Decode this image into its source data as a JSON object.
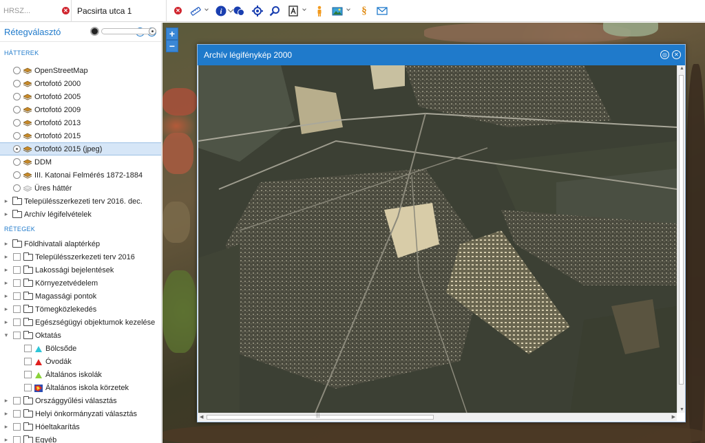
{
  "toolbar": {
    "hrsz_placeholder": "HRSZ...",
    "street_value": "Pacsirta utca 1",
    "icons": [
      "measure-icon",
      "info-icon",
      "identify-icon",
      "locate-icon",
      "search-icon",
      "print-icon",
      "person-icon",
      "map-export-icon",
      "paragraph-icon",
      "mail-icon"
    ],
    "paragraph_glyph": "§",
    "info_glyph": "i"
  },
  "sidebar": {
    "title": "Rétegválasztó",
    "backgrounds_label": "HÁTTEREK",
    "backgrounds": [
      {
        "label": "OpenStreetMap",
        "selected": false
      },
      {
        "label": "Ortofotó 2000",
        "selected": false
      },
      {
        "label": "Ortofotó 2005",
        "selected": false
      },
      {
        "label": "Ortofotó 2009",
        "selected": false
      },
      {
        "label": "Ortofotó 2013",
        "selected": false
      },
      {
        "label": "Ortofotó 2015",
        "selected": false
      },
      {
        "label": "Ortofotó 2015 (jpeg)",
        "selected": true
      },
      {
        "label": "DDM",
        "selected": false
      },
      {
        "label": "III. Katonai Felmérés 1872-1884",
        "selected": false
      },
      {
        "label": "Üres háttér",
        "selected": false
      }
    ],
    "background_folders": [
      "Településszerkezeti terv 2016. dec.",
      "Archív légifelvételek"
    ],
    "layers_label": "RÉTEGEK",
    "layers_top": "Földhivatali alaptérkép",
    "layer_groups": [
      "Településszerkezeti terv 2016",
      "Lakossági bejelentések",
      "Környezetvédelem",
      "Magassági pontok",
      "Tömegközlekedés",
      "Egészségügyi objektumok kezelése",
      "Oktatás"
    ],
    "education_items": [
      {
        "label": "Bölcsőde",
        "icon": "cyan-triangle-icon",
        "color": "#2ec6d8"
      },
      {
        "label": "Óvodák",
        "icon": "red-triangle-icon",
        "color": "#e0201e"
      },
      {
        "label": "Általános iskolák",
        "icon": "green-triangle-icon",
        "color": "#8ad23a"
      },
      {
        "label": "Általános iskola körzetek",
        "icon": "district-map-icon",
        "color": "#e03020"
      }
    ],
    "layer_groups_bottom": [
      "Országgyűlési választás",
      "Helyi önkormányzati választás",
      "Hóeltakarítás",
      "Egyéb"
    ]
  },
  "dialog": {
    "title": "Archív légifénykép 2000",
    "scroll_glyph": "|||"
  },
  "colors": {
    "accent": "#1f7acb",
    "selected_row": "#d6e6f7"
  }
}
